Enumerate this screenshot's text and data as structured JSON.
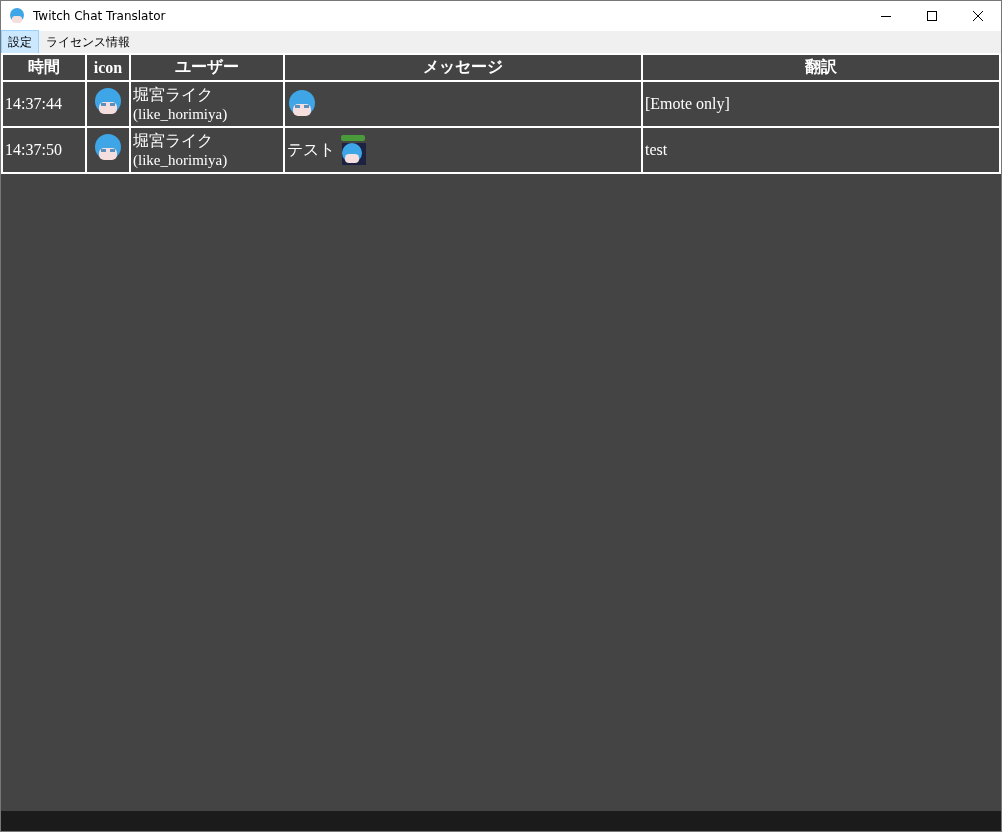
{
  "window": {
    "title": "Twitch Chat Translator"
  },
  "menu": [
    {
      "label": "設定",
      "selected": true
    },
    {
      "label": "ライセンス情報",
      "selected": false
    }
  ],
  "table": {
    "columns": [
      "時間",
      "icon",
      "ユーザー",
      "メッセージ",
      "翻訳"
    ],
    "rows": [
      {
        "time": "14:37:44",
        "display_name": "堀宮ライク",
        "login": "(like_horimiya)",
        "message": [
          {
            "kind": "emote"
          }
        ],
        "translation": "[Emote only]"
      },
      {
        "time": "14:37:50",
        "display_name": "堀宮ライク",
        "login": "(like_horimiya)",
        "message": [
          {
            "kind": "text",
            "text": "テスト"
          },
          {
            "kind": "sticker"
          }
        ],
        "translation": "test"
      }
    ]
  }
}
